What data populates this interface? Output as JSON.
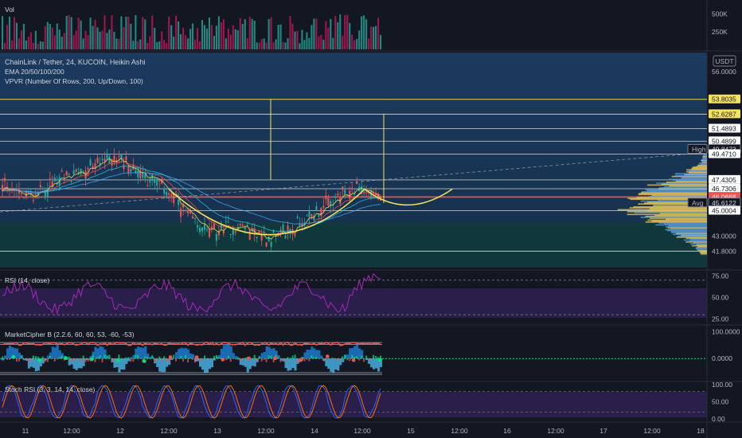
{
  "header": {
    "vol_label": "Vol",
    "symbol_title": "ChainLink / Tether, 24, KUCOIN, Heikin Ashi",
    "ema_label": "EMA 20/50/100/200",
    "vpvr_label": "VPVR (Number Of Rows, 200, Up/Down, 100)",
    "currency": "USDT"
  },
  "colors": {
    "background": "#131722",
    "up": "#26a69a",
    "down": "#ef5350",
    "hline": "#d1d4dc",
    "yellow": "#f5e35b",
    "rsi": "#9c27b0"
  },
  "chart_data": [
    {
      "type": "bar",
      "pane": "volume",
      "title": "Vol",
      "ylim": [
        0,
        700000
      ],
      "yticks": [
        "500K",
        "250K"
      ],
      "yticks_values": [
        500000,
        250000
      ]
    },
    {
      "type": "candlestick",
      "pane": "price",
      "title": "ChainLink / Tether, 24, KUCOIN, Heikin Ashi",
      "ylim": [
        40.5,
        57.5
      ],
      "yticks": [
        "56.0000",
        "43.0000",
        "41.8000"
      ],
      "yticks_values": [
        56.0,
        43.0,
        41.8
      ],
      "price_labels": [
        {
          "text": "53.8035",
          "value": 53.8035,
          "style": "yellow"
        },
        {
          "text": "52.6287",
          "value": 52.6287,
          "style": "yellow"
        },
        {
          "text": "51.4893",
          "value": 51.4893,
          "style": "white"
        },
        {
          "text": "50.4899",
          "value": 50.4899,
          "style": "white"
        },
        {
          "text": "49.8473",
          "value": 49.8473,
          "style": "dark",
          "prefix": "High"
        },
        {
          "text": "49.4710",
          "value": 49.471,
          "style": "white"
        },
        {
          "text": "47.4305",
          "value": 47.4305,
          "style": "white"
        },
        {
          "text": "46.7306",
          "value": 46.7306,
          "style": "white"
        },
        {
          "text": "46.0966",
          "value": 46.0966,
          "style": "red"
        },
        {
          "text": "46.0668",
          "value": 46.0668,
          "style": "red"
        },
        {
          "text": "45.6122",
          "value": 45.6122,
          "style": "dark",
          "prefix": "Avg"
        },
        {
          "text": "45.0004",
          "value": 45.0004,
          "style": "white"
        }
      ],
      "ema_series": [
        "EMA 20",
        "EMA 50",
        "EMA 100",
        "EMA 200"
      ],
      "horizontal_levels": [
        53.8035,
        52.6287,
        51.4893,
        50.4899,
        49.471,
        47.4305,
        46.7306,
        46.0966,
        46.0668,
        45.0004,
        41.8
      ]
    },
    {
      "type": "line",
      "pane": "rsi",
      "title": "RSI (14, close)",
      "ylim": [
        20,
        80
      ],
      "yticks": [
        "75.00",
        "50.00",
        "25.00"
      ],
      "yticks_values": [
        75,
        50,
        25
      ],
      "bands": [
        70,
        30
      ]
    },
    {
      "type": "area",
      "pane": "marketcipher",
      "title": "MarketCipher B (2.2.6, 60, 60, 53, -60, -53)",
      "ylim": [
        -80,
        120
      ],
      "yticks": [
        "100.0000",
        "0.0000"
      ],
      "yticks_values": [
        100,
        0
      ]
    },
    {
      "type": "line",
      "pane": "stochrsi",
      "title": "Stoch RSI (3, 3, 14, 14, close)",
      "ylim": [
        -5,
        105
      ],
      "yticks": [
        "100.00",
        "50.00",
        "0.00"
      ],
      "yticks_values": [
        100,
        50,
        0
      ]
    }
  ],
  "time_axis": {
    "ticks": [
      "11",
      "12:00",
      "12",
      "12:00",
      "13",
      "12:00",
      "14",
      "12:00",
      "15",
      "12:00",
      "16",
      "12:00",
      "17",
      "12:00",
      "18"
    ]
  }
}
